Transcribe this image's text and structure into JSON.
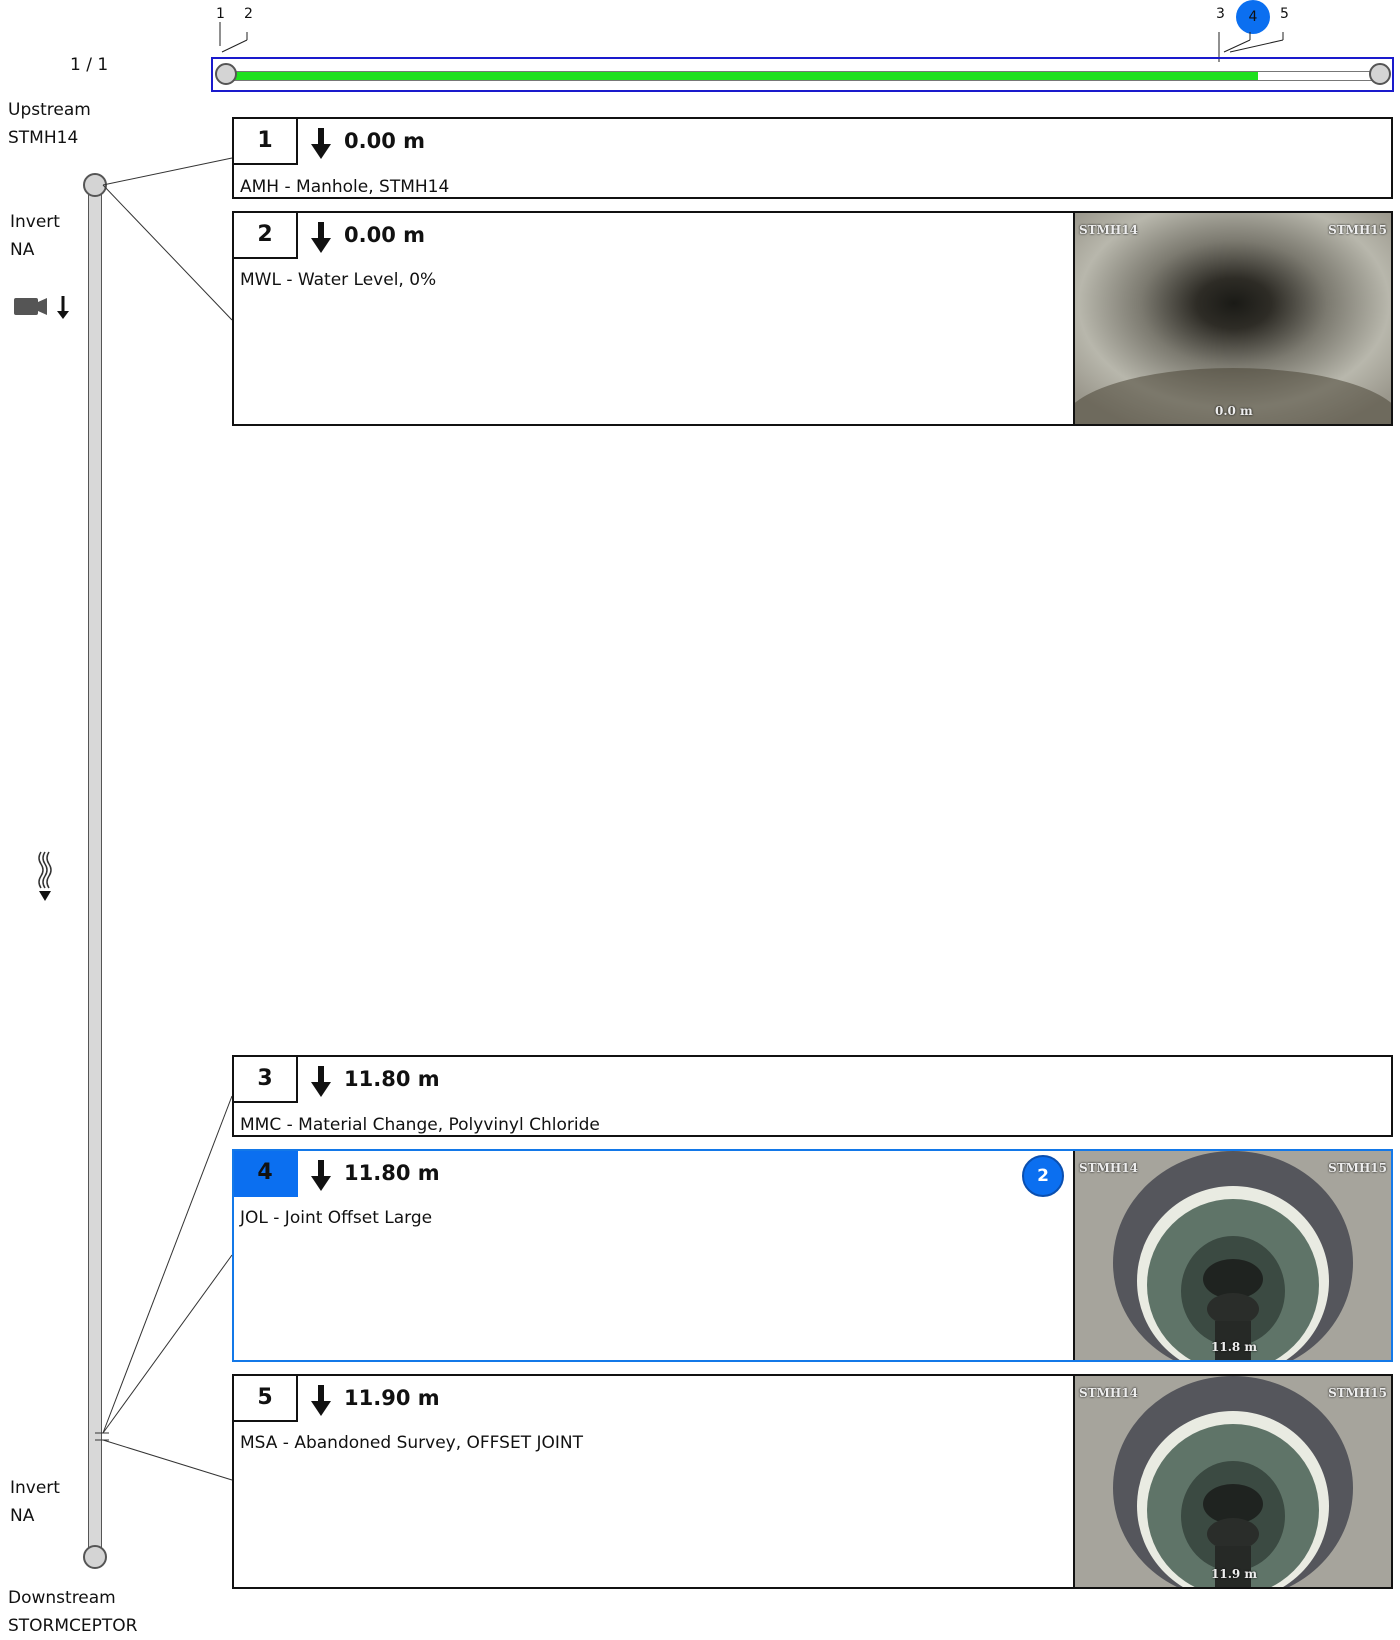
{
  "overview": {
    "markers": [
      "1",
      "2",
      "3",
      "4",
      "5"
    ],
    "selected_marker": "4",
    "page": "1 / 1",
    "progress_fraction": 0.89
  },
  "left": {
    "upstream_label": "Upstream",
    "upstream_name": "STMH14",
    "invert_top_label": "Invert",
    "invert_top_value": "NA",
    "invert_bottom_label": "Invert",
    "invert_bottom_value": "NA",
    "downstream_label": "Downstream",
    "downstream_name": "STORMCEPTOR",
    "camera_icon": "camera-direction-icon",
    "flow_icon": "flow-direction-icon"
  },
  "observations": [
    {
      "num": "1",
      "distance": "0.00 m",
      "description": "AMH - Manhole, STMH14"
    },
    {
      "num": "2",
      "distance": "0.00 m",
      "description": "MWL - Water Level, 0%",
      "photo": {
        "left": "STMH14",
        "right": "STMH15",
        "distance": "0.0 m"
      }
    },
    {
      "num": "3",
      "distance": "11.80 m",
      "description": "MMC - Material Change, Polyvinyl Chloride"
    },
    {
      "num": "4",
      "distance": "11.80 m",
      "description": "JOL - Joint Offset Large",
      "badge": "2",
      "selected": true,
      "photo": {
        "left": "STMH14",
        "right": "STMH15",
        "distance": "11.8 m"
      }
    },
    {
      "num": "5",
      "distance": "11.90 m",
      "description": "MSA - Abandoned Survey, OFFSET JOINT",
      "photo": {
        "left": "STMH14",
        "right": "STMH15",
        "distance": "11.9 m"
      }
    }
  ],
  "colors": {
    "progress": "#1fe01f",
    "selection": "#0b6ff0",
    "frame": "#1a1acc"
  }
}
